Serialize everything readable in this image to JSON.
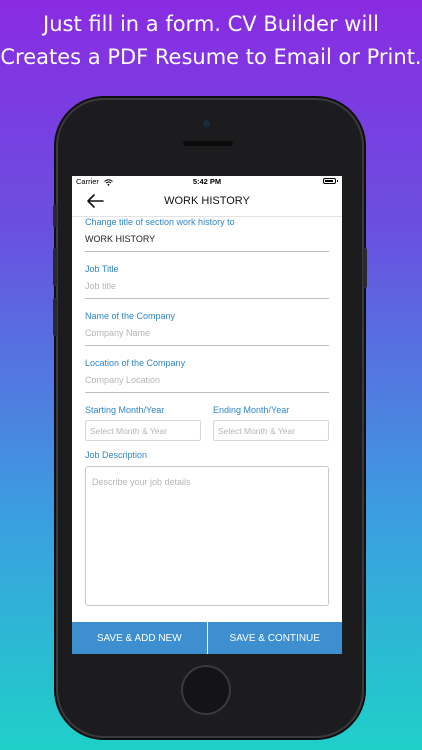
{
  "promo": {
    "line1": "Just fill in a form. CV Builder will",
    "line2": "Creates a PDF Resume to Email or Print."
  },
  "status_bar": {
    "carrier": "Carrier",
    "time": "5:42 PM"
  },
  "nav": {
    "title": "WORK HISTORY"
  },
  "form": {
    "section_title_label": "Change title of section work history to",
    "section_title_value": "WORK HISTORY",
    "job_title_label": "Job Title",
    "job_title_placeholder": "Job title",
    "company_name_label": "Name of the Company",
    "company_name_placeholder": "Company Name",
    "company_location_label": "Location of the Company",
    "company_location_placeholder": "Company Location",
    "start_label": "Starting Month/Year",
    "start_placeholder": "Select Month & Year",
    "end_label": "Ending Month/Year",
    "end_placeholder": "Select Month & Year",
    "description_label": "Job Description",
    "description_placeholder": "Describe your job details"
  },
  "actions": {
    "save_add_new": "SAVE & ADD NEW",
    "save_continue": "SAVE & CONTINUE"
  },
  "colors": {
    "accent": "#2f86c6",
    "button": "#3d8fcf"
  }
}
